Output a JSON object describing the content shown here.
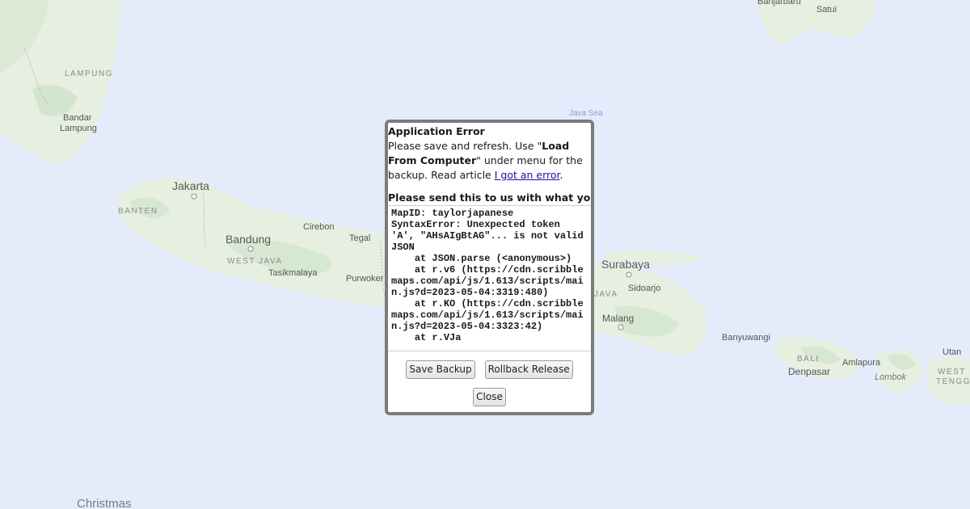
{
  "map": {
    "labels": {
      "banjarbaru": "Banjarbaru",
      "satui": "Satui",
      "lampung": "LAMPUNG",
      "bandar_lampung": "Bandar Lampung",
      "java_sea": "Java Sea",
      "jakarta": "Jakarta",
      "banten": "BANTEN",
      "cirebon": "Cirebon",
      "bandung": "Bandung",
      "tegal": "Tegal",
      "west_java": "WEST JAVA",
      "tasikmalaya": "Tasikmalaya",
      "purwokerto": "Purwoker",
      "surabaya": "Surabaya",
      "sidoarjo": "Sidoarjo",
      "east_java": "JAVA",
      "malang": "Malang",
      "banyuwangi": "Banyuwangi",
      "bali": "BALI",
      "denpasar": "Denpasar",
      "amlapura": "Amlapura",
      "lombok": "Lombok",
      "utan": "Utan",
      "west_nusa": "WEST",
      "tengga": "TENGG",
      "christmas": "Christmas"
    },
    "colors": {
      "sea": "#e4ecfb",
      "land": "#e8f0e3",
      "land_green": "#d6e8d4"
    }
  },
  "dialog": {
    "title": "Application Error",
    "line1_prefix": "Please save and refresh. Use \"",
    "line1_bold": "Load From Computer",
    "line1_suffix": "\" under menu for the backup.",
    "line2_prefix": "Read article ",
    "link_text": "I got an error",
    "line2_suffix": ".",
    "send_text": "Please send this to us with what you",
    "log": "MapID: taylorjapanese\nSyntaxError: Unexpected token 'A', \"AHsAIgBtAG\"... is not valid JSON\n    at JSON.parse (<anonymous>)\n    at r.v6 (https://cdn.scribblemaps.com/api/js/1.613/scripts/main.js?d=2023-05-04:3319:480)\n    at r.KO (https://cdn.scribblemaps.com/api/js/1.613/scripts/main.js?d=2023-05-04:3323:42)\n    at r.VJa",
    "save_backup": "Save Backup",
    "rollback_release": "Rollback Release",
    "close": "Close"
  }
}
